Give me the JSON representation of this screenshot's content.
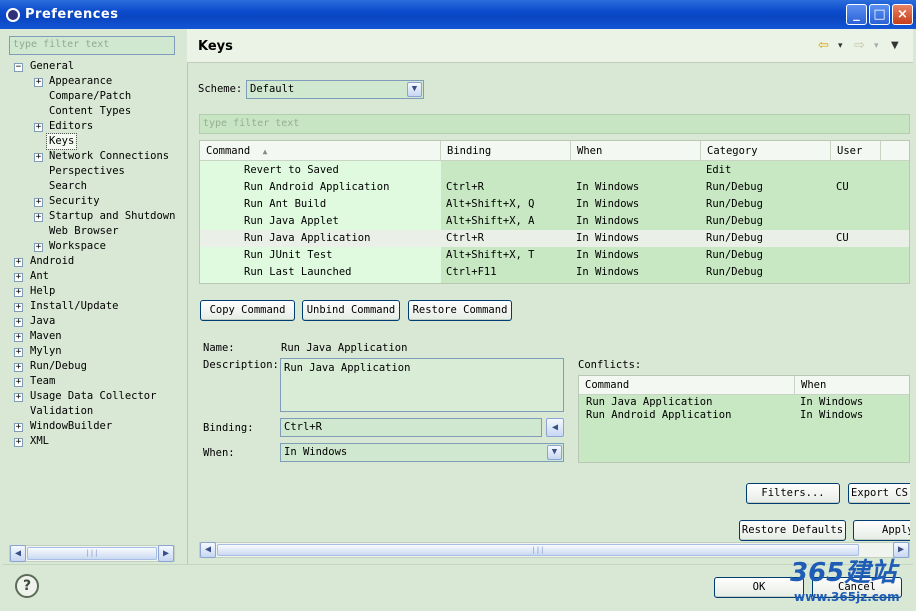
{
  "window": {
    "title": "Preferences",
    "minimize": "_",
    "maximize": "□",
    "close": "×"
  },
  "tree": {
    "filter_placeholder": "type filter text",
    "items": [
      {
        "label": "General",
        "toggle": "−"
      },
      {
        "label": "Appearance",
        "toggle": "+"
      },
      {
        "label": "Compare/Patch"
      },
      {
        "label": "Content Types"
      },
      {
        "label": "Editors",
        "toggle": "+"
      },
      {
        "label": "Keys"
      },
      {
        "label": "Network Connections",
        "toggle": "+"
      },
      {
        "label": "Perspectives"
      },
      {
        "label": "Search"
      },
      {
        "label": "Security",
        "toggle": "+"
      },
      {
        "label": "Startup and Shutdown",
        "toggle": "+"
      },
      {
        "label": "Web Browser"
      },
      {
        "label": "Workspace",
        "toggle": "+"
      },
      {
        "label": "Android",
        "toggle": "+"
      },
      {
        "label": "Ant",
        "toggle": "+"
      },
      {
        "label": "Help",
        "toggle": "+"
      },
      {
        "label": "Install/Update",
        "toggle": "+"
      },
      {
        "label": "Java",
        "toggle": "+"
      },
      {
        "label": "Maven",
        "toggle": "+"
      },
      {
        "label": "Mylyn",
        "toggle": "+"
      },
      {
        "label": "Run/Debug",
        "toggle": "+"
      },
      {
        "label": "Team",
        "toggle": "+"
      },
      {
        "label": "Usage Data Collector",
        "toggle": "+"
      },
      {
        "label": "Validation"
      },
      {
        "label": "WindowBuilder",
        "toggle": "+"
      },
      {
        "label": "XML",
        "toggle": "+"
      }
    ]
  },
  "page": {
    "title": "Keys",
    "nav": {
      "back": "⇦",
      "forward": "⇨",
      "dropdown": "▾",
      "menu": "▼"
    },
    "scheme_label": "Scheme:",
    "scheme_value": "Default",
    "filter_placeholder": "type filter text"
  },
  "table": {
    "columns": [
      "Command",
      "Binding",
      "When",
      "Category",
      "User"
    ],
    "sort_indicator": "▲",
    "rows": [
      {
        "command": "Revert to Saved",
        "binding": "",
        "when": "",
        "category": "Edit",
        "user": ""
      },
      {
        "command": "Run Android Application",
        "binding": "Ctrl+R",
        "when": "In Windows",
        "category": "Run/Debug",
        "user": "CU"
      },
      {
        "command": "Run Ant Build",
        "binding": "Alt+Shift+X, Q",
        "when": "In Windows",
        "category": "Run/Debug",
        "user": ""
      },
      {
        "command": "Run Java Applet",
        "binding": "Alt+Shift+X, A",
        "when": "In Windows",
        "category": "Run/Debug",
        "user": ""
      },
      {
        "command": "Run Java Application",
        "binding": "Ctrl+R",
        "when": "In Windows",
        "category": "Run/Debug",
        "user": "CU"
      },
      {
        "command": "Run JUnit Test",
        "binding": "Alt+Shift+X, T",
        "when": "In Windows",
        "category": "Run/Debug",
        "user": ""
      },
      {
        "command": "Run Last Launched",
        "binding": "Ctrl+F11",
        "when": "In Windows",
        "category": "Run/Debug",
        "user": ""
      }
    ]
  },
  "buttons": {
    "copy": "Copy Command",
    "unbind": "Unbind Command",
    "restore": "Restore Command",
    "filters": "Filters...",
    "export": "Export CS",
    "restore_defaults": "Restore Defaults",
    "apply": "Apply",
    "ok": "OK",
    "cancel": "Cancel"
  },
  "details": {
    "name_label": "Name:",
    "name_value": "Run Java Application",
    "description_label": "Description:",
    "description_value": "Run Java Application",
    "binding_label": "Binding:",
    "binding_value": "Ctrl+R",
    "binding_btn": "◀",
    "when_label": "When:",
    "when_value": "In Windows",
    "conflicts_label": "Conflicts:"
  },
  "conflicts": {
    "columns": [
      "Command",
      "When"
    ],
    "rows": [
      {
        "command": "Run Java Application",
        "when": "In Windows"
      },
      {
        "command": "Run Android Application",
        "when": "In Windows"
      }
    ]
  },
  "scroll": {
    "left_arrow": "◀",
    "right_arrow": "▶",
    "grip": "|||"
  },
  "help": {
    "symbol": "?"
  },
  "watermark": {
    "brand": "365建站",
    "url": "www.365jz.com"
  }
}
